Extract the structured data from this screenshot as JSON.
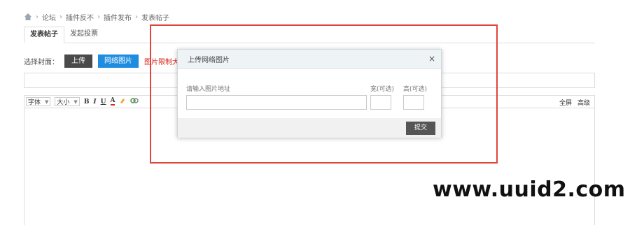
{
  "breadcrumb": {
    "items": [
      "论坛",
      "插件反不",
      "插件发布",
      "发表帖子"
    ],
    "separator": "›"
  },
  "tabs": [
    {
      "label": "发表帖子",
      "active": true
    },
    {
      "label": "发起投票",
      "active": false
    }
  ],
  "cover": {
    "label": "选择封面：",
    "upload_label": "上传",
    "net_image_label": "网络图片",
    "tip": "图片限制大小为"
  },
  "editor": {
    "font_select": "字体",
    "size_select": "大小",
    "buttons": [
      "B",
      "I",
      "U",
      "A"
    ],
    "right_links": [
      "全屏",
      "高级"
    ]
  },
  "modal": {
    "title": "上传网络图片",
    "close_symbol": "×",
    "url_placeholder": "请输入图片地址",
    "width_label": "宽(可选)",
    "height_label": "高(可选)",
    "submit_label": "提交"
  },
  "watermark": "www.uuid2.com",
  "colors": {
    "primary_blue": "#1e8de0",
    "dark_button": "#4a4a4a",
    "highlight_red": "#e0443b",
    "tip_red": "#d9281e"
  }
}
